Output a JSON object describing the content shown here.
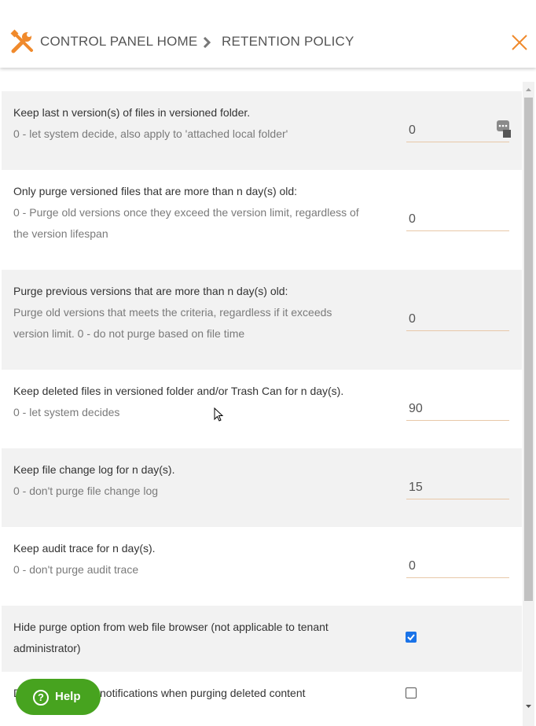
{
  "header": {
    "home_label": "CONTROL PANEL HOME",
    "current_label": "RETENTION POLICY"
  },
  "settings": [
    {
      "title": "Keep last n version(s) of files in versioned folder.",
      "desc": "0 - let system decide, also apply to 'attached local folder'",
      "value": "0"
    },
    {
      "title": "Only purge versioned files that are more than n day(s) old:",
      "desc1": "0 - Purge old versions once they exceed the version limit, regardless of",
      "desc2": "the version lifespan",
      "value": "0"
    },
    {
      "title": "Purge previous versions that are more than n day(s) old:",
      "desc1": "Purge old versions that meets the criteria, regardless if it exceeds",
      "desc2": "version limit. 0 - do not purge based on file time",
      "value": "0"
    },
    {
      "title": "Keep deleted files in versioned folder and/or Trash Can for n day(s).",
      "desc": "0 - let system decides",
      "value": "90"
    },
    {
      "title": "Keep file change log for n day(s).",
      "desc": "0 - don't purge file change log",
      "value": "15"
    },
    {
      "title": "Keep audit trace for n day(s).",
      "desc": "0 - don't purge audit trace",
      "value": "0"
    },
    {
      "title1": "Hide purge option from web file browser (not applicable to tenant",
      "title2": "administrator)",
      "checked": true
    },
    {
      "title_visible": "notifications when purging deleted content",
      "title_prefix": "D",
      "checked": false
    }
  ],
  "help": {
    "label": "Help",
    "glyph": "?"
  },
  "colors": {
    "accent": "#f08a2c",
    "row_gray": "#f2f2f2",
    "help_green": "#47a31f",
    "checkbox_blue": "#1a73e8"
  },
  "icons": {
    "tools": "tools-icon",
    "separator": "chevron-right-icon",
    "close": "close-icon",
    "field_menu": "ellipsis-badge-icon"
  }
}
